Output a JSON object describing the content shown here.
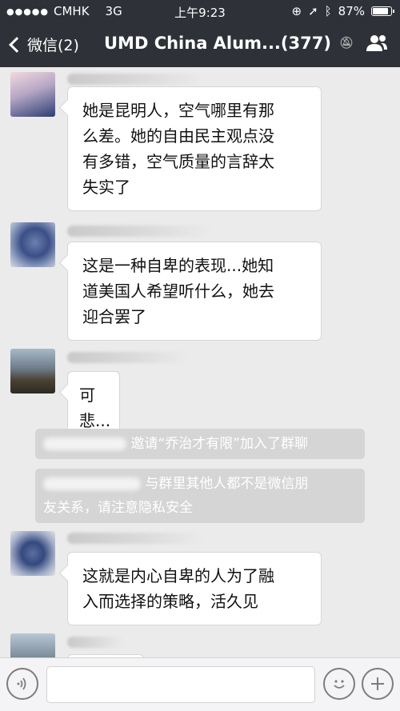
{
  "status_bar": {
    "carrier": "CMHK",
    "network": "3G",
    "time": "上午9:23",
    "battery": "87%",
    "battery_level": 0.87
  },
  "nav": {
    "back_label": "微信(2)",
    "title": "UMD China Alum...(377)"
  },
  "messages": [
    {
      "lines": [
        "她是昆明人，空气哪里有那",
        "么差。她的自由民主观点没",
        "有多错，空气质量的言辞太",
        "失实了"
      ]
    },
    {
      "lines": [
        "这是一种自卑的表现...她知",
        "道美国人希望听什么，她去",
        "迎合罢了"
      ]
    },
    {
      "lines": [
        "可悲..."
      ]
    },
    {
      "lines": [
        "这就是内心自卑的人为了融",
        "入而选择的策略，活久见"
      ]
    }
  ],
  "system_notices": {
    "invite": "邀请“乔治才有限”加入了群聊",
    "privacy_line1": "与群里其他人都不是微信朋",
    "privacy_line2": "友关系，请注意隐私安全"
  },
  "icons": [
    "back-arrow-icon",
    "mute-icon",
    "group-contacts-icon",
    "voice-icon",
    "emoji-icon",
    "plus-icon",
    "location-icon",
    "bluetooth-icon"
  ]
}
